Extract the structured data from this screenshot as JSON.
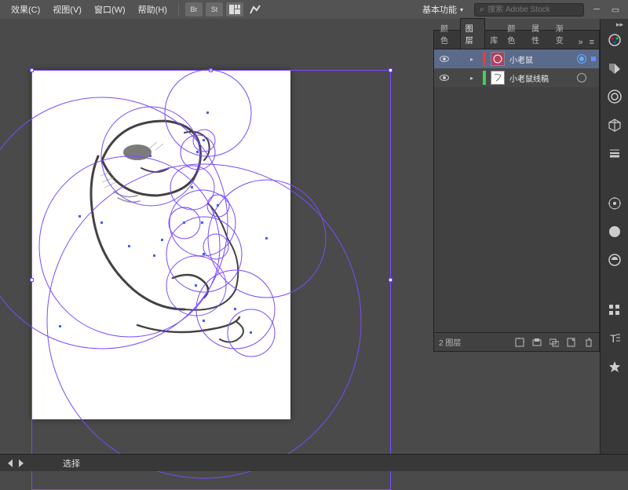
{
  "menu": {
    "effects": "效果(C)",
    "view": "视图(V)",
    "window": "窗口(W)",
    "help": "帮助(H)"
  },
  "toolbar": {
    "br": "Br",
    "st": "St"
  },
  "workspace": {
    "label": "基本功能"
  },
  "search": {
    "placeholder": "搜索 Adobe Stock"
  },
  "panel": {
    "tabs": {
      "color": "颜色",
      "layers": "图层",
      "libraries": "库",
      "color2": "颜色",
      "properties": "属性",
      "gradient": "渐变"
    },
    "layers": [
      {
        "name": "小老鼠",
        "color": "#e04040",
        "selected": true,
        "thumb_bg": "#b04060"
      },
      {
        "name": "小老鼠线稿",
        "color": "#40d060",
        "selected": false,
        "thumb_bg": "#ffffff"
      }
    ],
    "footer_count": "2 图层"
  },
  "status": {
    "tool": "选择"
  },
  "colors": {
    "selection": "#7a4aff",
    "sketch": "#2a2a2a"
  }
}
